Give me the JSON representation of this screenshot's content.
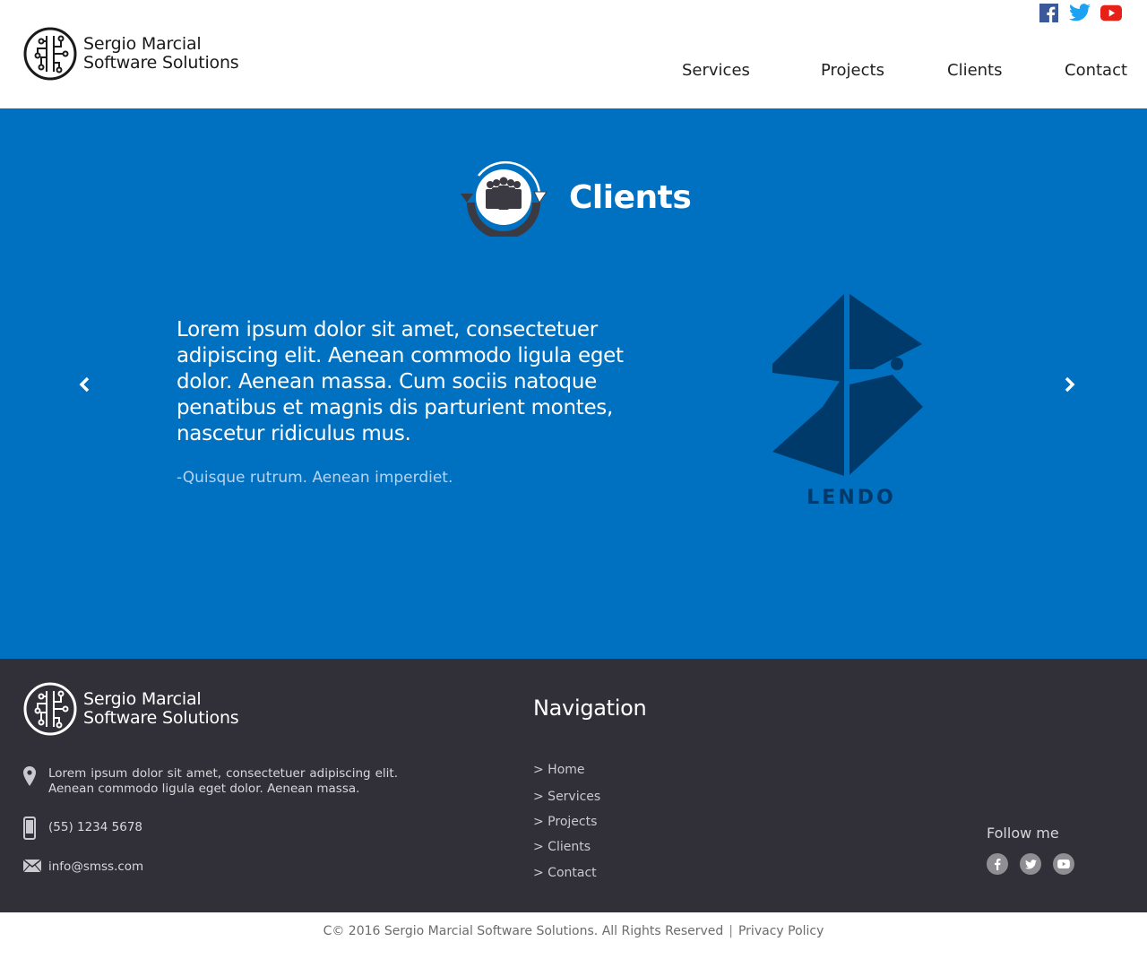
{
  "brand": {
    "line1": "Sergio Marcial",
    "line2": "Software Solutions"
  },
  "social_top": [
    {
      "name": "facebook-icon",
      "color": "#3b5998"
    },
    {
      "name": "twitter-icon",
      "color": "#1da1f2"
    },
    {
      "name": "youtube-icon",
      "color": "#e62117"
    }
  ],
  "nav": {
    "items": [
      "Services",
      "Projects",
      "Clients",
      "Contact"
    ]
  },
  "hero": {
    "title": "Clients",
    "quote": "Lorem ipsum dolor sit amet, consectetuer adipiscing elit. Aenean commodo ligula eget dolor. Aenean massa. Cum sociis natoque penatibus et magnis dis parturient montes, nascetur ridiculus mus.",
    "author": "-Quisque rutrum. Aenean imperdiet.",
    "client_logo_text": "LENDO",
    "accent": "#0070c0"
  },
  "footer": {
    "brand": {
      "line1": "Sergio Marcial",
      "line2": "Software Solutions"
    },
    "address": "Lorem ipsum dolor sit amet, consectetuer adipiscing elit. Aenean commodo ligula eget dolor. Aenean massa.",
    "phone": "(55) 1234 5678",
    "email": "info@smss.com",
    "nav_title": "Navigation",
    "nav_items": [
      "> Home",
      "> Services",
      "> Projects",
      "> Clients",
      "> Contact"
    ],
    "follow_label": "Follow me",
    "background": "#313038"
  },
  "copyright": {
    "text": "C© 2016 Sergio Marcial Software Solutions. All Rights Reserved",
    "separator": "|",
    "privacy": "Privacy Policy"
  }
}
